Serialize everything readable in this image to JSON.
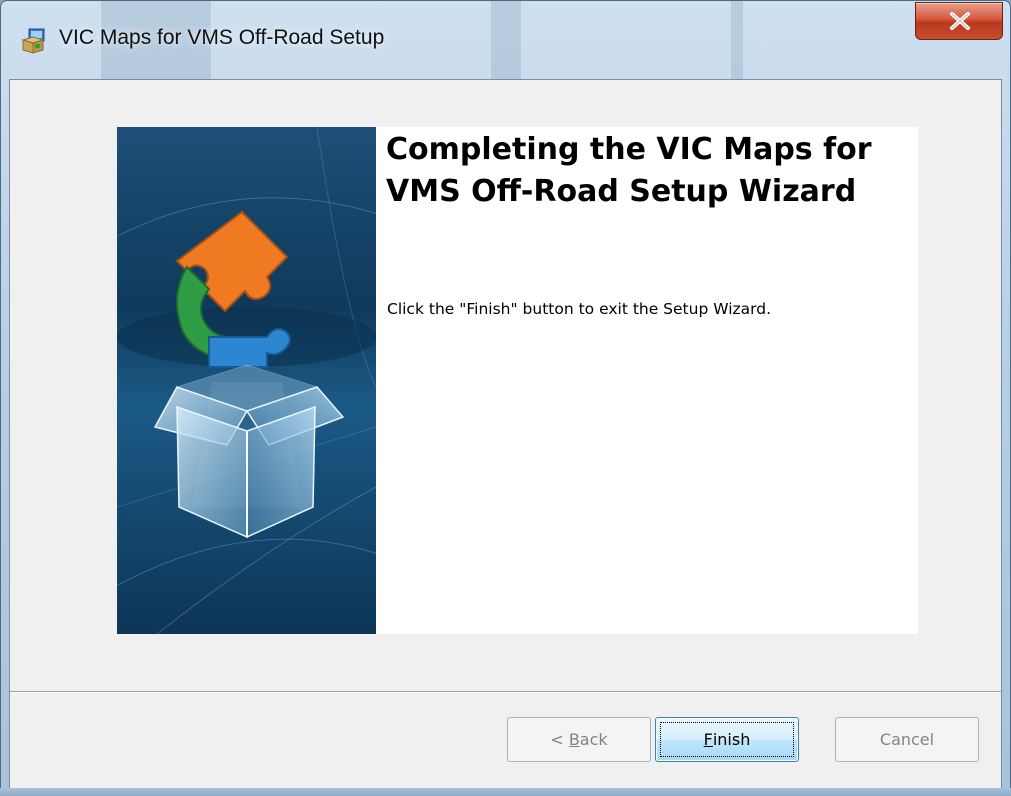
{
  "window": {
    "title": "VIC Maps for VMS Off-Road Setup"
  },
  "wizard": {
    "heading": "Completing the VIC Maps for VMS Off-Road Setup Wizard",
    "message": "Click the \"Finish\" button to exit the Setup Wizard."
  },
  "buttons": {
    "back": {
      "prefix": "< ",
      "mnemonic": "B",
      "rest": "ack",
      "enabled": false
    },
    "finish": {
      "mnemonic": "F",
      "rest": "inish",
      "enabled": true,
      "focused": true
    },
    "cancel": {
      "label": "Cancel",
      "enabled": false
    }
  },
  "icons": {
    "app": "installer-package-icon",
    "close": "close-icon",
    "banner": "puzzle-box-icon"
  },
  "colors": {
    "close_button": "#c94d2d",
    "banner_background": "#0f3a5c",
    "finish_border": "#3c7fb1"
  }
}
